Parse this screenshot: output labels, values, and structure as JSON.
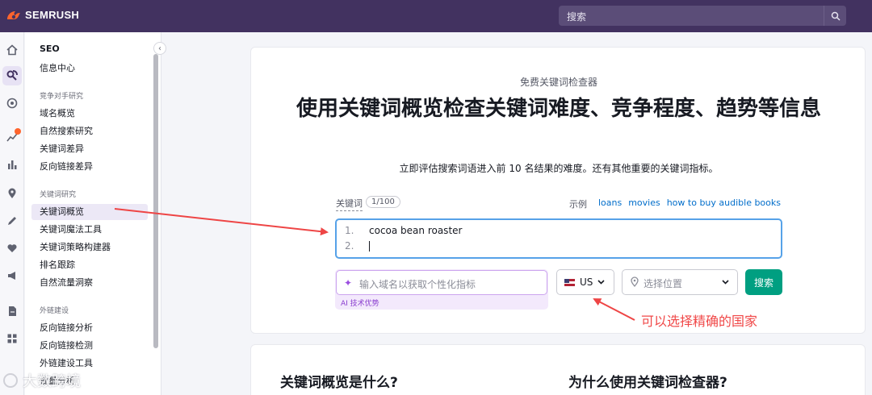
{
  "app": {
    "brand": "SEMRUSH"
  },
  "top_search": {
    "placeholder": "搜索"
  },
  "sidebar": {
    "title": "SEO",
    "items": [
      {
        "label": "信息中心"
      },
      {
        "section": "竞争对手研究"
      },
      {
        "label": "域名概览"
      },
      {
        "label": "自然搜索研究"
      },
      {
        "label": "关键词差异"
      },
      {
        "label": "反向链接差异"
      },
      {
        "section": "关键词研究"
      },
      {
        "label": "关键词概览"
      },
      {
        "label": "关键词魔法工具"
      },
      {
        "label": "关键词策略构建器"
      },
      {
        "label": "排名跟踪"
      },
      {
        "label": "自然流量洞察"
      },
      {
        "section": "外链建设"
      },
      {
        "label": "反向链接分析"
      },
      {
        "label": "反向链接检测"
      },
      {
        "label": "外链建设工具"
      },
      {
        "label": "批量分析"
      }
    ]
  },
  "main": {
    "eyebrow": "免费关键词检查器",
    "headline": "使用关键词概览检查关键词难度、竞争程度、趋势等信息",
    "subtitle": "立即评估搜索词语进入前 10 名结果的难度。还有其他重要的关键词指标。",
    "keyword_label": "关键词",
    "keyword_count": "1/100",
    "examples_label": "示例",
    "examples": [
      "loans",
      "movies",
      "how to buy audible books"
    ],
    "lines": [
      {
        "num": "1.",
        "text": "cocoa bean roaster"
      },
      {
        "num": "2.",
        "text": ""
      }
    ],
    "ai_placeholder": "输入域名以获取个性化指标",
    "ai_tag": "AI 技术优势",
    "country": "US",
    "location_placeholder": "选择位置",
    "search_button": "搜索"
  },
  "second_card": {
    "left_heading": "关键词概览是什么?",
    "right_heading": "为什么使用关键词检查器?"
  },
  "annotation": {
    "text": "可以选择精确的国家"
  },
  "watermark": {
    "text": "大数跨境"
  },
  "colors": {
    "topbar": "#423260",
    "accent": "#009f81",
    "annotation": "#f04848",
    "focus": "#56a2e8"
  }
}
